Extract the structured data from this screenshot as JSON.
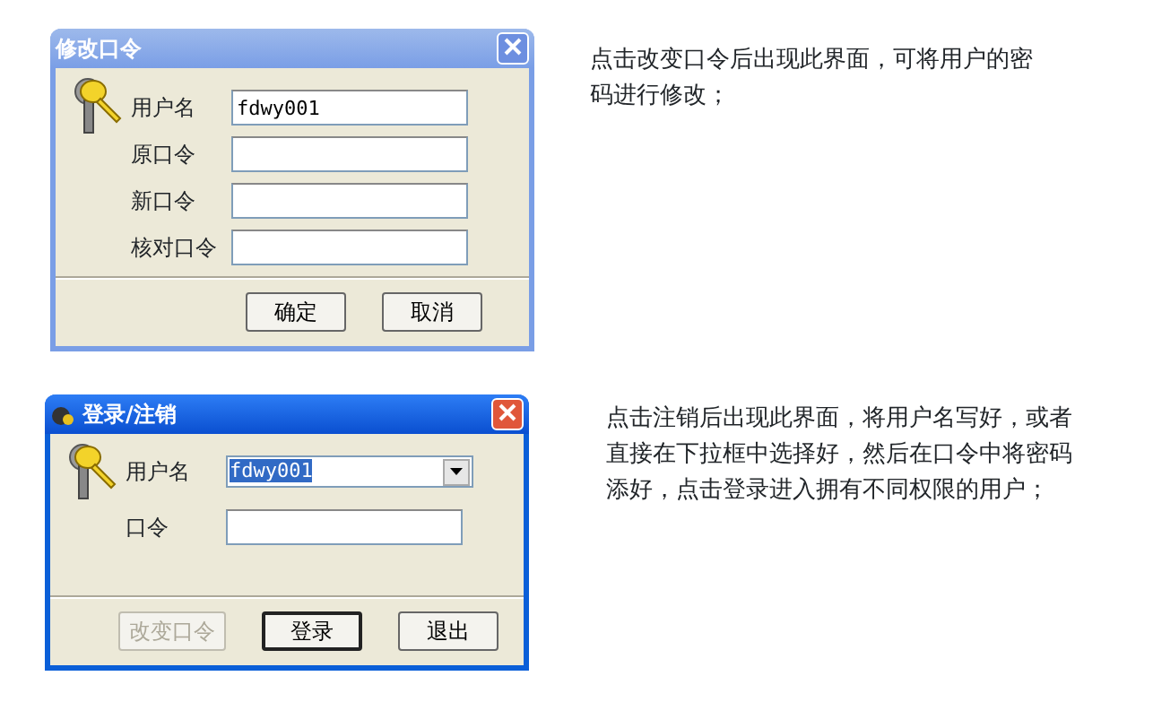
{
  "sections": [
    {
      "dialog": {
        "title": "修改口令",
        "active": false,
        "app_icon": false,
        "fields": [
          {
            "label": "用户名",
            "kind": "text",
            "value": "fdwy001",
            "highlighted": false
          },
          {
            "label": "原口令",
            "kind": "text"
          },
          {
            "label": "新口令",
            "kind": "text"
          },
          {
            "label": "核对口令",
            "kind": "text"
          }
        ],
        "buttons": [
          {
            "label": "确定",
            "disabled": false,
            "default": false
          },
          {
            "label": "取消",
            "disabled": false,
            "default": false
          }
        ]
      },
      "description": "点击改变口令后出现此界面，可将用户的密码进行修改；"
    },
    {
      "dialog": {
        "title": "登录/注销",
        "active": true,
        "app_icon": true,
        "fields": [
          {
            "label": "用户名",
            "kind": "combo",
            "value": "fdwy001",
            "highlighted": true
          },
          {
            "label": "口令",
            "kind": "text"
          }
        ],
        "buttons": [
          {
            "label": "改变口令",
            "disabled": true,
            "default": false
          },
          {
            "label": "登录",
            "disabled": false,
            "default": true
          },
          {
            "label": "退出",
            "disabled": false,
            "default": false
          }
        ]
      },
      "description": "点击注销后出现此界面，将用户名写好，或者直接在下拉框中选择好，然后在口令中将密码添好，点击登录进入拥有不同权限的用户；"
    }
  ]
}
